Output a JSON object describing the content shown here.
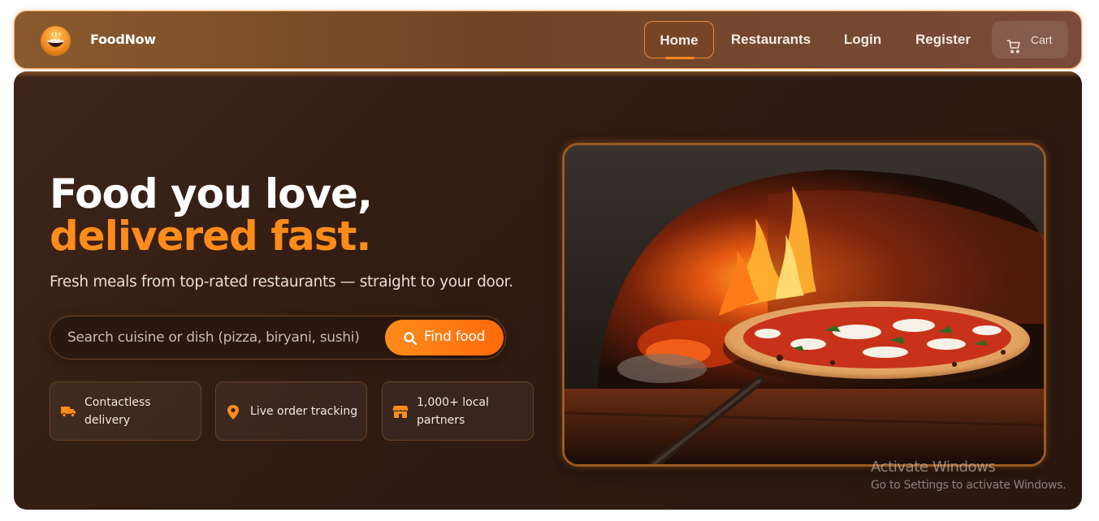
{
  "brand": {
    "name": "FoodNow",
    "logo_icon": "bowl-icon"
  },
  "nav": {
    "items": [
      {
        "label": "Home",
        "active": true
      },
      {
        "label": "Restaurants",
        "active": false
      },
      {
        "label": "Login",
        "active": false
      },
      {
        "label": "Register",
        "active": false
      }
    ],
    "cart": {
      "label": "Cart",
      "icon": "cart-icon"
    }
  },
  "hero": {
    "headline_line1": "Food you love,",
    "headline_line2": "delivered fast.",
    "subtitle": "Fresh meals from top-rated restaurants — straight to your door.",
    "search": {
      "placeholder": "Search cuisine or dish (pizza, biryani, sushi)",
      "value": "",
      "button_label": "Find food",
      "button_icon": "search-icon"
    },
    "features": [
      {
        "label": "Contactless delivery",
        "icon": "truck-icon"
      },
      {
        "label": "Live order tracking",
        "icon": "map-pin-icon"
      },
      {
        "label": "1,000+ local partners",
        "icon": "store-icon"
      }
    ],
    "image": {
      "subject": "wood-fired-pizza-oven"
    }
  },
  "os_watermark": {
    "line1": "Activate Windows",
    "line2": "Go to Settings to activate Windows."
  },
  "colors": {
    "accent": "#ff8c1a",
    "hero_bg": "#2f1b12",
    "nav_bg": "#7a4a2c"
  }
}
